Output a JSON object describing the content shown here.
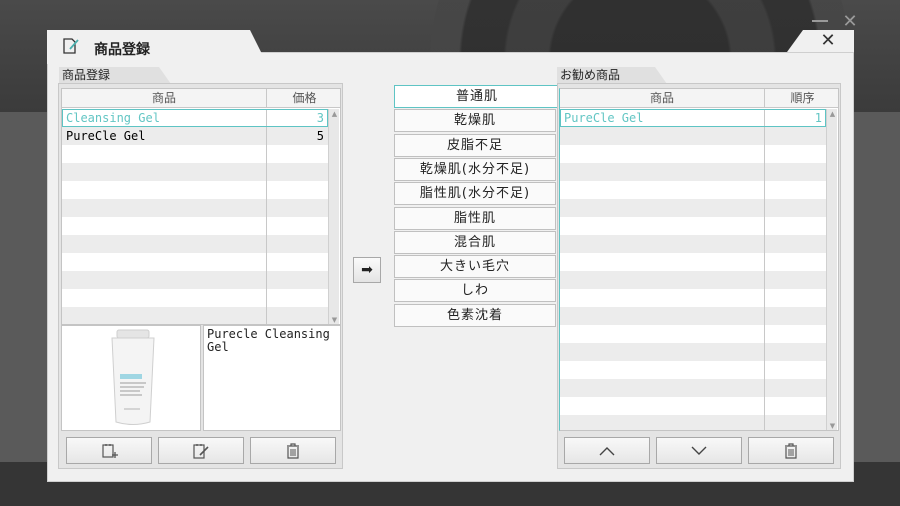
{
  "dialog": {
    "title": "商品登録",
    "close_label": "✕"
  },
  "left_panel": {
    "tab": "商品登録",
    "columns": [
      "商品",
      "価格"
    ],
    "rows": [
      {
        "name": "Cleansing Gel",
        "value": "3"
      },
      {
        "name": "PureCle Gel",
        "value": "5"
      }
    ],
    "description": "Purecle Cleansing Gel",
    "product_image_label": "PURECLE"
  },
  "categories": [
    "普通肌",
    "乾燥肌",
    "皮脂不足",
    "乾燥肌(水分不足)",
    "脂性肌(水分不足)",
    "脂性肌",
    "混合肌",
    "大きい毛穴",
    "しわ",
    "色素沈着"
  ],
  "transfer_button": "➡",
  "right_panel": {
    "tab": "お勧め商品",
    "columns": [
      "商品",
      "順序"
    ],
    "rows": [
      {
        "name": "PureCle Gel",
        "value": "1"
      }
    ]
  },
  "icons": {
    "add": "add-item-icon",
    "edit": "edit-item-icon",
    "delete": "trash-icon",
    "up": "chevron-up-icon",
    "down": "chevron-down-icon"
  },
  "colors": {
    "accent": "#5ec4c4",
    "selected_text": "#63c6c4"
  }
}
